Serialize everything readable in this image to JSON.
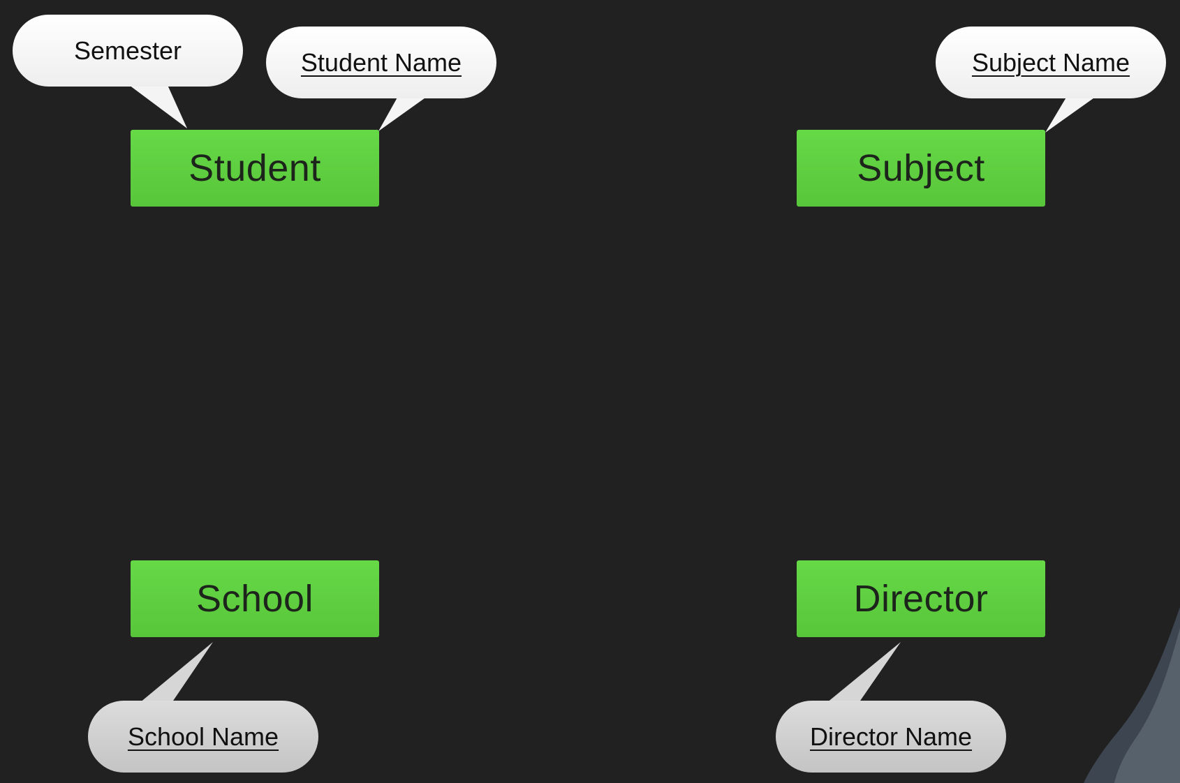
{
  "diagram": {
    "entities": [
      {
        "id": "student",
        "label": "Student"
      },
      {
        "id": "subject",
        "label": "Subject"
      },
      {
        "id": "school",
        "label": "School"
      },
      {
        "id": "director",
        "label": "Director"
      }
    ],
    "attributes": [
      {
        "id": "semester",
        "label": "Semester",
        "key": false,
        "entity": "student"
      },
      {
        "id": "student-name",
        "label": "Student Name",
        "key": true,
        "entity": "student"
      },
      {
        "id": "subject-name",
        "label": "Subject Name",
        "key": true,
        "entity": "subject"
      },
      {
        "id": "school-name",
        "label": "School Name",
        "key": true,
        "entity": "school"
      },
      {
        "id": "director-name",
        "label": "Director Name",
        "key": true,
        "entity": "director"
      }
    ]
  },
  "colors": {
    "background": "#212121",
    "entity_fill": "#5fd040",
    "entity_text": "#1d241b",
    "bubble_white": "#ffffff",
    "bubble_grey": "#d0d0d0"
  }
}
